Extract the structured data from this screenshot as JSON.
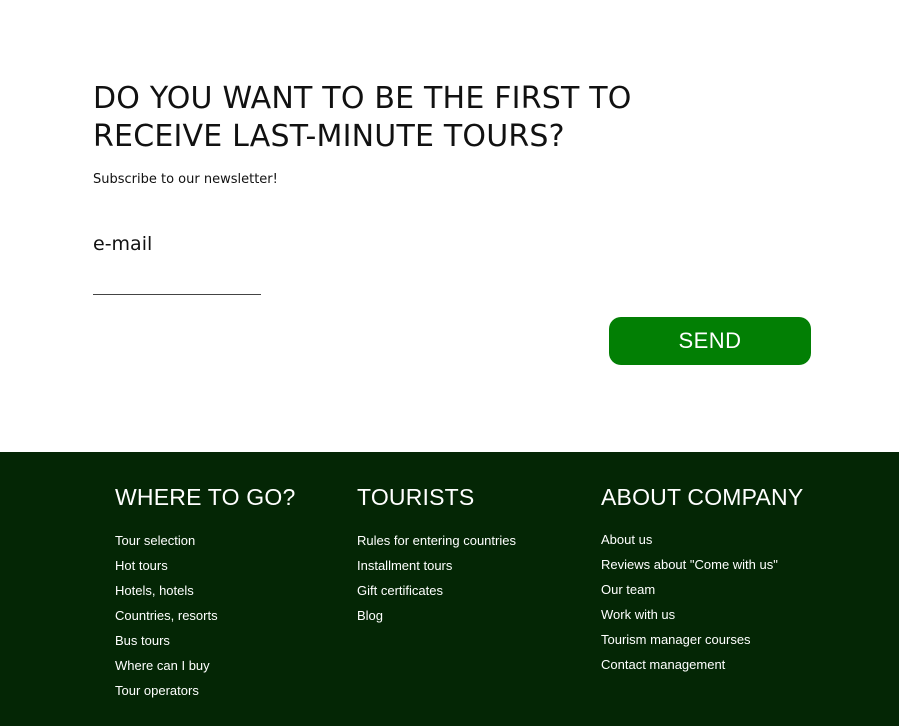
{
  "newsletter": {
    "headline_line1": "DO YOU WANT TO BE THE FIRST TO",
    "headline_line2": "RECEIVE LAST-MINUTE TOURS?",
    "subtitle": "Subscribe to our newsletter!",
    "email_label": "e-mail",
    "email_value": "",
    "send_label": "SEND",
    "button_color": "#027f04"
  },
  "footer": {
    "background_color": "#042605",
    "columns": [
      {
        "title": "WHERE TO GO?",
        "links": [
          "Tour selection",
          "Hot tours",
          "Hotels, hotels",
          "Countries, resorts",
          "Bus tours",
          "Where can I buy",
          "Tour operators"
        ]
      },
      {
        "title": "TOURISTS",
        "links": [
          "Rules for entering countries",
          "Installment tours",
          "Gift certificates",
          "Blog"
        ]
      },
      {
        "title": "ABOUT COMPANY",
        "links": [
          "About us",
          "Reviews about \"Come with us\"",
          "Our team",
          "Work with us",
          "Tourism manager courses",
          "Contact management"
        ]
      }
    ]
  }
}
